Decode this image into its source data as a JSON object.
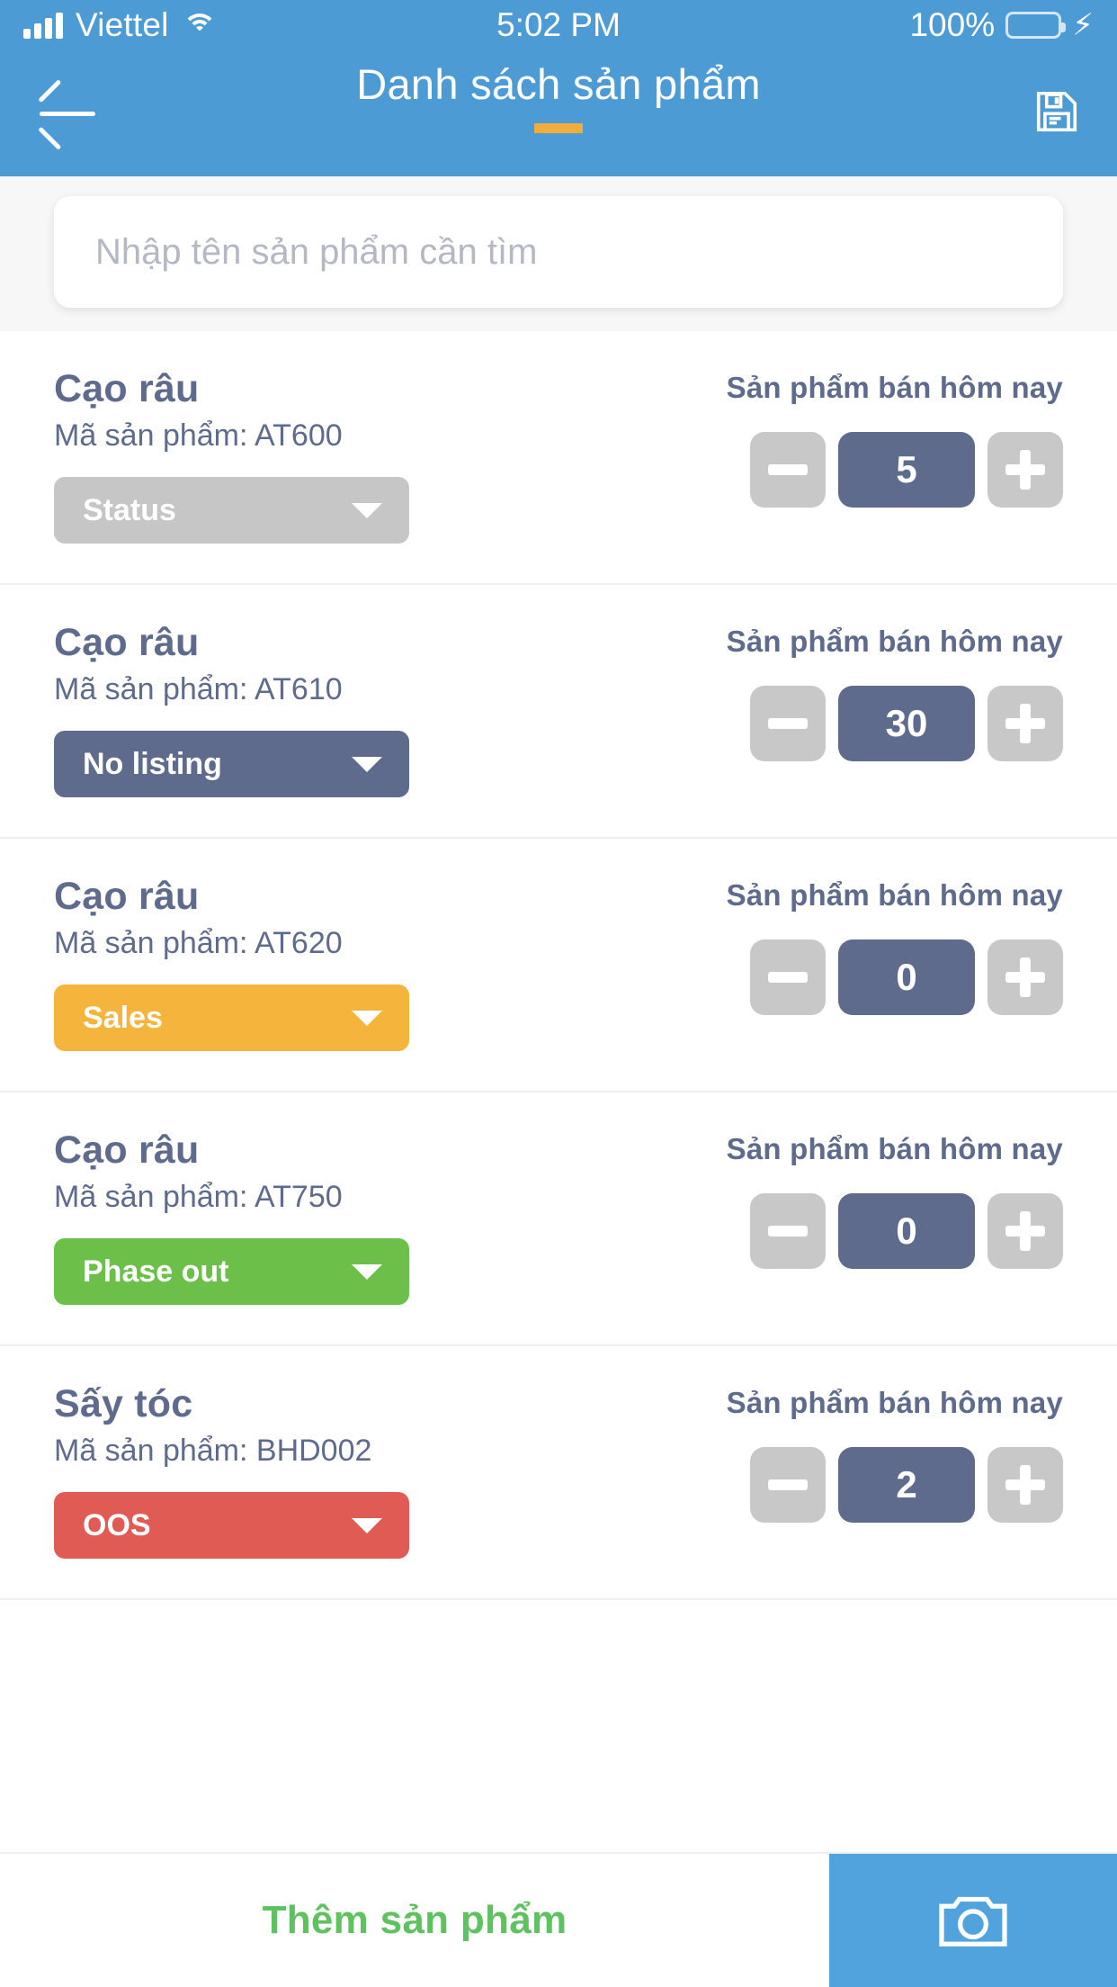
{
  "status_bar": {
    "carrier": "Viettel",
    "time": "5:02 PM",
    "battery_percent": "100%",
    "signal_icon": "signal-bars-icon",
    "wifi_icon": "wifi-icon",
    "battery_icon": "battery-full-icon",
    "charging_icon": "charging-bolt-icon",
    "accent_color": "#4d9bd5",
    "battery_color": "#6edb63"
  },
  "header": {
    "title": "Danh sách sản phẩm",
    "back_icon": "back-arrow-icon",
    "save_icon": "save-floppy-icon",
    "underline_color": "#f0ad3c",
    "background_color": "#4d9bd5"
  },
  "search": {
    "placeholder": "Nhập tên sản phẩm cần tìm",
    "value": ""
  },
  "list": {
    "sold_today_label": "Sản phẩm bán hôm nay",
    "code_prefix": "Mã sản phẩm: ",
    "minus_icon": "minus-icon",
    "plus_icon": "plus-icon",
    "dropdown_icon": "chevron-down-icon",
    "products": [
      {
        "name": "Cạo râu",
        "code_line": "Mã sản phẩm: AT600",
        "status": "Status",
        "status_color": "#c6c6c6",
        "quantity": "5"
      },
      {
        "name": "Cạo râu",
        "code_line": "Mã sản phẩm: AT610",
        "status": "No listing",
        "status_color": "#5f6b8c",
        "quantity": "30"
      },
      {
        "name": "Cạo râu",
        "code_line": "Mã sản phẩm: AT620",
        "status": "Sales",
        "status_color": "#f5b53c",
        "quantity": "0"
      },
      {
        "name": "Cạo râu",
        "code_line": "Mã sản phẩm: AT750",
        "status": "Phase out",
        "status_color": "#6cc04a",
        "quantity": "0"
      },
      {
        "name": "Sấy tóc",
        "code_line": "Mã sản phẩm: BHD002",
        "status": "OOS",
        "status_color": "#e05b54",
        "quantity": "2"
      }
    ]
  },
  "bottom_bar": {
    "add_label": "Thêm sản phẩm",
    "add_color": "#5fc15f",
    "camera_icon": "camera-icon",
    "camera_button_color": "#51a3dd"
  }
}
